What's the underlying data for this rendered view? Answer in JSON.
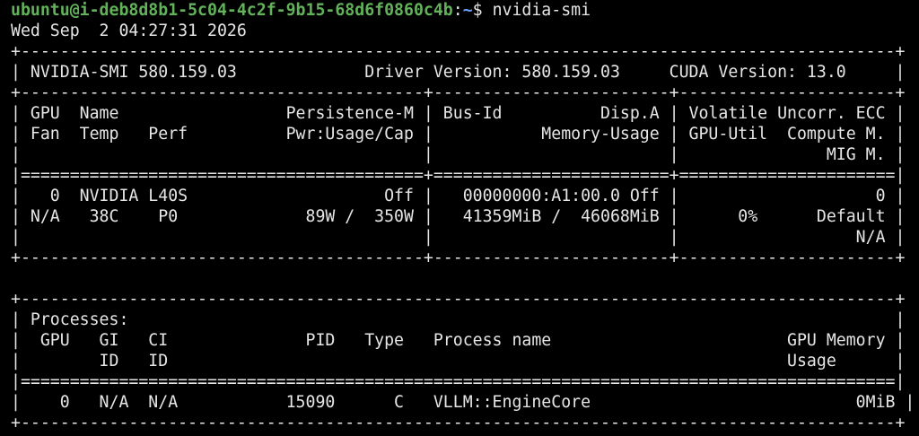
{
  "prompt": {
    "user_host": "ubuntu@i-deb8d8b1-5c04-4c2f-9b15-68d6f0860c4b",
    "separator": ":",
    "path": "~",
    "symbol": "$ ",
    "command": "nvidia-smi"
  },
  "colors": {
    "background": "#000000",
    "foreground": "#e6e6e6",
    "prompt_user": "#62b25a",
    "prompt_path": "#6aa0ff"
  },
  "output_lines": [
    "Wed Sep  2 04:27:31 2026",
    "+-----------------------------------------------------------------------------------------+",
    "| NVIDIA-SMI 580.159.03             Driver Version: 580.159.03     CUDA Version: 13.0     |",
    "+-----------------------------------------+------------------------+----------------------+",
    "| GPU  Name                 Persistence-M | Bus-Id          Disp.A | Volatile Uncorr. ECC |",
    "| Fan  Temp   Perf          Pwr:Usage/Cap |           Memory-Usage | GPU-Util  Compute M. |",
    "|                                         |                        |               MIG M. |",
    "|=========================================+========================+======================|",
    "|   0  NVIDIA L40S                    Off |   00000000:A1:00.0 Off |                    0 |",
    "| N/A   38C    P0             89W /  350W |   41359MiB /  46068MiB |      0%      Default |",
    "|                                         |                        |                  N/A |",
    "+-----------------------------------------+------------------------+----------------------+",
    "",
    "+-----------------------------------------------------------------------------------------+",
    "| Processes:                                                                              |",
    "|  GPU   GI   CI              PID   Type   Process name                        GPU Memory |",
    "|        ID   ID                                                               Usage      |",
    "|=========================================================================================|",
    "|    0   N/A  N/A           15090      C   VLLM::EngineCore                           0MiB |",
    "+-----------------------------------------------------------------------------------------+"
  ]
}
